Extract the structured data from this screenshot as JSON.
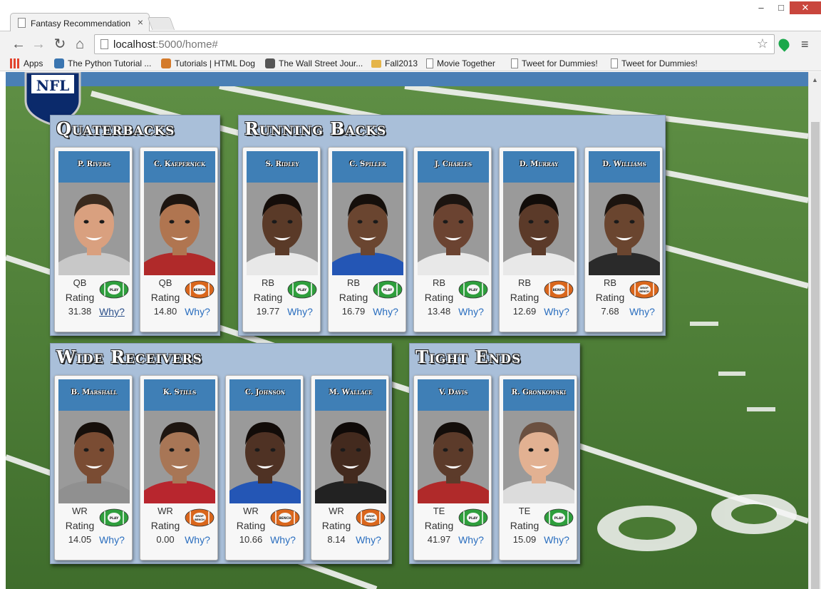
{
  "browser": {
    "tab_title": "Fantasy Recommendation",
    "tab_close": "×",
    "url_host": "localhost",
    "url_path": ":5000/home#",
    "window_controls": {
      "minimize": "–",
      "maximize": "□",
      "close": "✕"
    },
    "nav": {
      "back": "←",
      "forward": "→",
      "reload": "↻",
      "home": "⌂",
      "star": "☆",
      "menu": "≡"
    }
  },
  "bookmarks": [
    {
      "label": "Apps",
      "icon": "apps-grid-icon",
      "color": "#e2452f"
    },
    {
      "label": "The Python Tutorial ...",
      "icon": "python-icon",
      "color": "#3a75b0"
    },
    {
      "label": "Tutorials | HTML Dog",
      "icon": "htmldog-icon",
      "color": "#d47a2a"
    },
    {
      "label": "The Wall Street Jour...",
      "icon": "wsj-icon",
      "color": "#555555"
    },
    {
      "label": "Fall2013",
      "icon": "folder-icon",
      "color": "#e5b54a"
    },
    {
      "label": "Movie Together",
      "icon": "page-icon",
      "color": "#888888"
    },
    {
      "label": "Tweet for Dummies!",
      "icon": "page-icon",
      "color": "#888888"
    },
    {
      "label": "Tweet for Dummies!",
      "icon": "page-icon",
      "color": "#888888"
    }
  ],
  "logo": {
    "text": "NFL"
  },
  "groups": {
    "qb": {
      "title": "Quaterbacks",
      "players": [
        {
          "name": "P. Rivers",
          "pos": "QB",
          "rating_label": "Rating",
          "rating": "31.38",
          "why": "Why?",
          "ball": "PLAY",
          "skin": "#d9a07f",
          "hair": "#3a2a1e",
          "jersey": "#c8c8c8"
        },
        {
          "name": "C. Kaepernick",
          "pos": "QB",
          "rating_label": "Rating",
          "rating": "14.80",
          "why": "Why?",
          "ball": "BENCH",
          "skin": "#b07550",
          "hair": "#1d1510",
          "jersey": "#b02a2a"
        }
      ]
    },
    "rb": {
      "title": "Running Backs",
      "players": [
        {
          "name": "S. Ridley",
          "pos": "RB",
          "rating_label": "Rating",
          "rating": "19.77",
          "why": "Why?",
          "ball": "PLAY",
          "skin": "#5a3a28",
          "hair": "#140d0a",
          "jersey": "#e8e8e8"
        },
        {
          "name": "C. Spiller",
          "pos": "RB",
          "rating_label": "Rating",
          "rating": "16.79",
          "why": "Why?",
          "ball": "PLAY",
          "skin": "#6a4530",
          "hair": "#150f0b",
          "jersey": "#2456b5"
        },
        {
          "name": "J. Charles",
          "pos": "RB",
          "rating_label": "Rating",
          "rating": "13.48",
          "why": "Why?",
          "ball": "PLAY",
          "skin": "#6b4331",
          "hair": "#1b1410",
          "jersey": "#e8e8e8"
        },
        {
          "name": "D. Murray",
          "pos": "RB",
          "rating_label": "Rating",
          "rating": "12.69",
          "why": "Why?",
          "ball": "BENCH",
          "skin": "#5b3a29",
          "hair": "#110c09",
          "jersey": "#e8e8e8"
        },
        {
          "name": "D. Williams",
          "pos": "RB",
          "rating_label": "Rating",
          "rating": "7.68",
          "why": "Why?",
          "ball": "DROP BENCH",
          "skin": "#6a452f",
          "hair": "#1c140f",
          "jersey": "#2a2a2a"
        }
      ]
    },
    "wr": {
      "title": "Wide Receivers",
      "players": [
        {
          "name": "B. Marshall",
          "pos": "WR",
          "rating_label": "Rating",
          "rating": "14.05",
          "why": "Why?",
          "ball": "PLAY",
          "skin": "#7a4c33",
          "hair": "#160f0b",
          "jersey": "#909090"
        },
        {
          "name": "K. Stills",
          "pos": "WR",
          "rating_label": "Rating",
          "rating": "0.00",
          "why": "Why?",
          "ball": "DROP BENCH",
          "skin": "#a87656",
          "hair": "#1e1510",
          "jersey": "#b8262e"
        },
        {
          "name": "C. Johnson",
          "pos": "WR",
          "rating_label": "Rating",
          "rating": "10.66",
          "why": "Why?",
          "ball": "BENCH",
          "skin": "#4f3224",
          "hair": "#120c09",
          "jersey": "#2456b5"
        },
        {
          "name": "M. Wallace",
          "pos": "WR",
          "rating_label": "Rating",
          "rating": "8.14",
          "why": "Why?",
          "ball": "DROP BENCH",
          "skin": "#432a1e",
          "hair": "#0f0a08",
          "jersey": "#222222"
        }
      ]
    },
    "te": {
      "title": "Tight Ends",
      "players": [
        {
          "name": "V. Davis",
          "pos": "TE",
          "rating_label": "Rating",
          "rating": "41.97",
          "why": "Why?",
          "ball": "PLAY",
          "skin": "#5c3b2a",
          "hair": "#130d0a",
          "jersey": "#b02a2a"
        },
        {
          "name": "R. Gronkowski",
          "pos": "TE",
          "rating_label": "Rating",
          "rating": "15.09",
          "why": "Why?",
          "ball": "PLAY",
          "skin": "#e2b192",
          "hair": "#6b5040",
          "jersey": "#dcdcdc"
        }
      ]
    }
  },
  "colors": {
    "name_bar": "#3f7fb6",
    "group_bg": "#a9bfd9",
    "play_ball": "#2e9e3c",
    "bench_ball": "#d9661c",
    "field": "#4b7a35"
  }
}
